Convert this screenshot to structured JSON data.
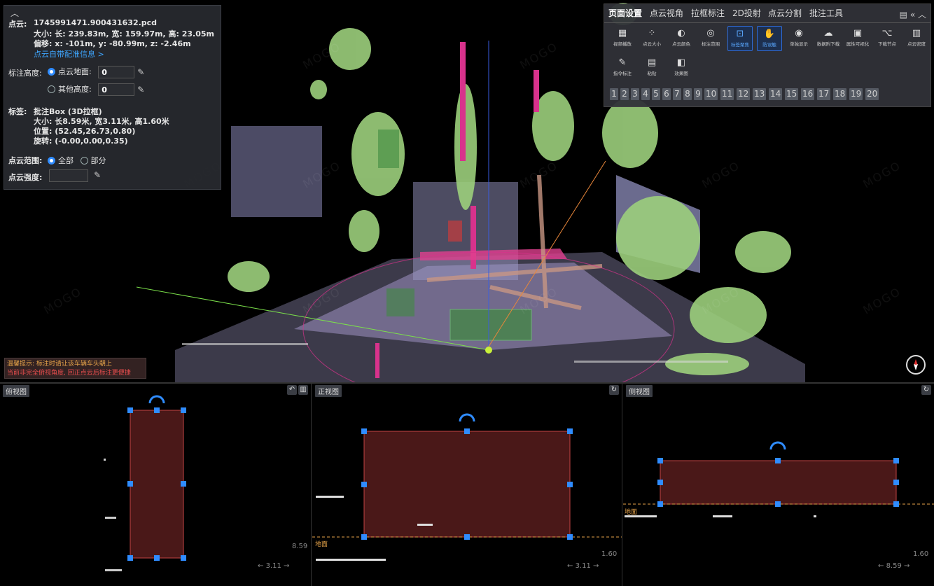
{
  "info": {
    "cloud_label": "点云:",
    "file": "1745991471.900431632.pcd",
    "size_line": "大小: 长: 239.83m, 宽: 159.97m, 高: 23.05m",
    "offset_line": "偏移: x: -101m, y: -80.99m, z: -2.46m",
    "config_link": "点云自带配准信息 >",
    "height_label": "标注高度:",
    "opt_ground": "点云地面:",
    "opt_ground_value": "0",
    "opt_other": "其他高度:",
    "opt_other_value": "0",
    "tag_label": "标签:",
    "tag_value": "批注Box (3D拉框)",
    "tag_size": "大小: 长8.59米, 宽3.11米, 高1.60米",
    "tag_pos": "位置: (52.45,26.73,0.80)",
    "tag_rot": "旋转: (-0.00,0.00,0.35)",
    "range_label": "点云范围:",
    "range_all": "全部",
    "range_part": "部分",
    "density_label": "点云强度:"
  },
  "toolbar": {
    "tabs": [
      "页面设置",
      "点云视角",
      "拉框标注",
      "2D投射",
      "点云分割",
      "批注工具"
    ],
    "tools": [
      {
        "label": "视频播放",
        "icon": "video-icon"
      },
      {
        "label": "点云大小",
        "icon": "dots-icon"
      },
      {
        "label": "点云颜色",
        "icon": "palette-icon"
      },
      {
        "label": "标注范围",
        "icon": "target-icon"
      },
      {
        "label": "标签聚焦",
        "icon": "focus-icon"
      },
      {
        "label": "防误触",
        "icon": "hand-icon"
      },
      {
        "label": "单独显示",
        "icon": "eye-icon"
      },
      {
        "label": "数据附下载",
        "icon": "download-cloud-icon"
      },
      {
        "label": "属性可视化",
        "icon": "chart-icon"
      },
      {
        "label": "下载节点",
        "icon": "nodes-icon"
      },
      {
        "label": "点云密度",
        "icon": "grid-icon"
      },
      {
        "label": "指令标注",
        "icon": "edit-icon"
      },
      {
        "label": "粘贴",
        "icon": "paste-icon"
      },
      {
        "label": "效果图",
        "icon": "preview-icon"
      }
    ],
    "numbers": [
      "1",
      "2",
      "3",
      "4",
      "5",
      "6",
      "7",
      "8",
      "9",
      "10",
      "11",
      "12",
      "13",
      "14",
      "15",
      "16",
      "17",
      "18",
      "19",
      "20"
    ]
  },
  "warning": {
    "line1": "温馨提示: 标注时请让该车辆车头朝上",
    "line2": "当前非完全俯视角度, 回正点云后标注更便捷"
  },
  "views": {
    "top": {
      "label": "俯视图",
      "height": "8.59",
      "width": "3.11"
    },
    "front": {
      "label": "正视图",
      "height": "1.60",
      "width": "3.11",
      "ground": "地面"
    },
    "side": {
      "label": "侧视图",
      "height": "1.60",
      "width": "8.59",
      "ground": "地面"
    }
  },
  "watermark": "MOGO"
}
